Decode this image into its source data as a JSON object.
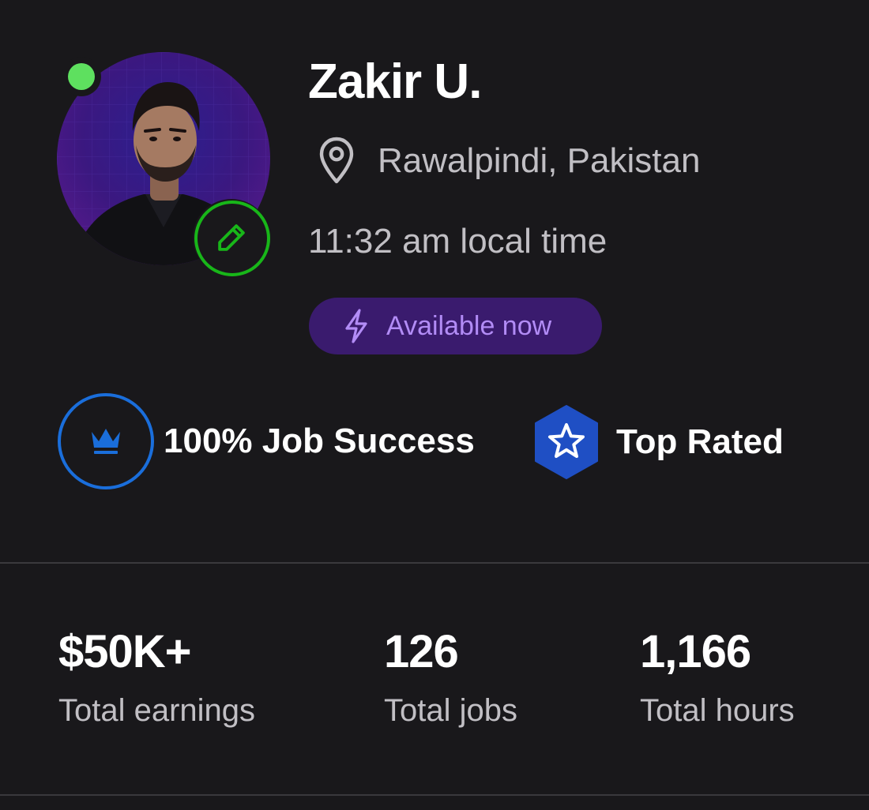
{
  "profile": {
    "name": "Zakir U.",
    "location": "Rawalpindi, Pakistan",
    "local_time": "11:32 am local time",
    "availability_label": "Available now",
    "online_status_color": "#5ee05f",
    "edit_ring_color": "#18b619",
    "availability_bg": "#3a1b6e",
    "availability_text_color": "#b28cf6"
  },
  "badges": {
    "job_success": "100% Job Success",
    "top_rated": "Top Rated",
    "job_success_icon": "crown-icon",
    "top_rated_icon": "star-hexagon-icon",
    "accent_blue": "#1a6edb"
  },
  "stats": [
    {
      "value": "$50K+",
      "label": "Total earnings"
    },
    {
      "value": "126",
      "label": "Total jobs"
    },
    {
      "value": "1,166",
      "label": "Total hours"
    }
  ]
}
